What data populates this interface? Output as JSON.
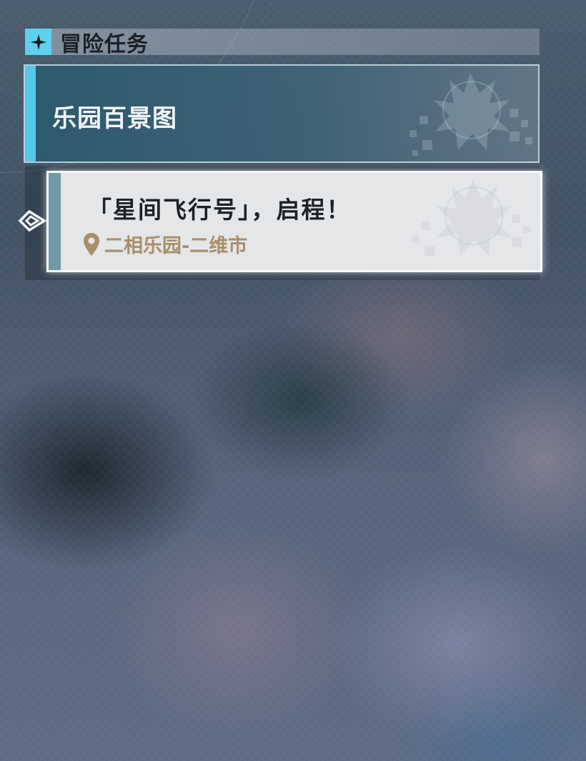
{
  "header": {
    "title": "冒险任务",
    "icon": "sparkle-star-icon",
    "accent_color": "#5fd0ee"
  },
  "category": {
    "label": "乐园百景图",
    "accent_color": "#55c8ea",
    "emblem": "dragon-emblem-icon"
  },
  "quests": [
    {
      "title": "「星间飞行号」，启程！",
      "location": "二相乐园-二维市",
      "location_icon": "map-pin-icon",
      "location_color": "#a88f6a",
      "selected": true,
      "accent_color": "#6f9aa8"
    }
  ]
}
